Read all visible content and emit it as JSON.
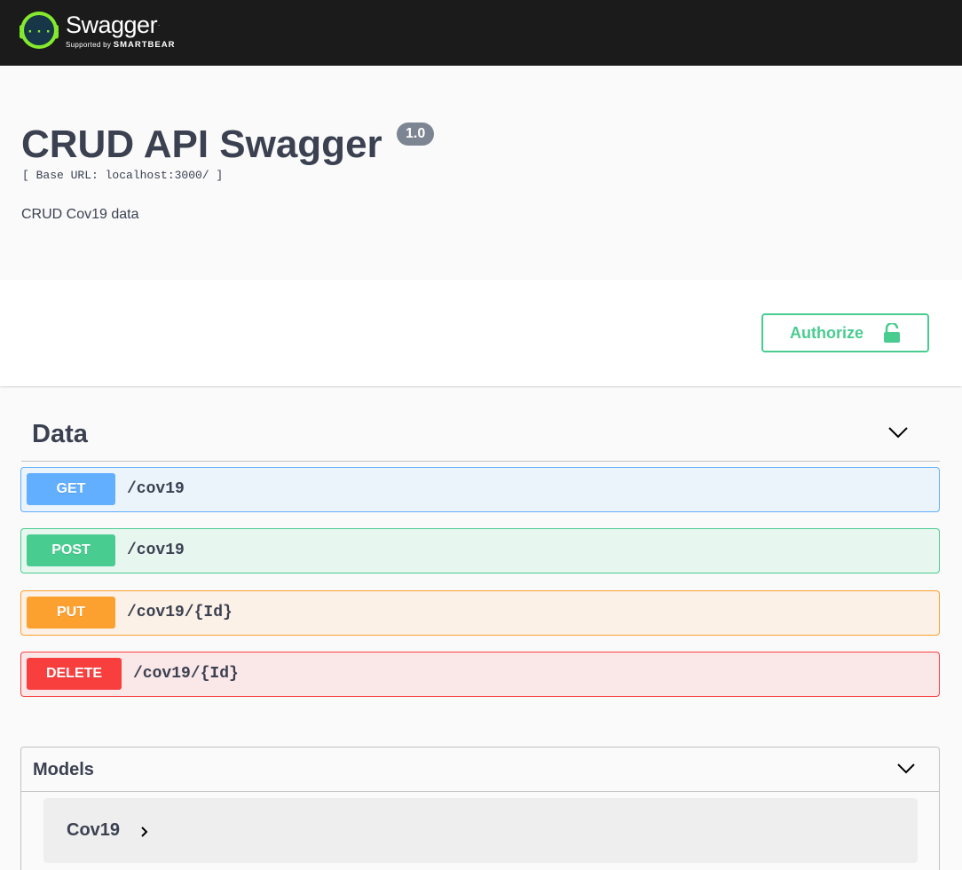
{
  "topbar": {
    "logo_title": "Swagger",
    "logo_sub_prefix": "Supported by",
    "logo_sub_brand": "SMARTBEAR"
  },
  "info": {
    "title": "CRUD API Swagger",
    "version": "1.0",
    "base_url": "[ Base URL: localhost:3000/ ]",
    "description": "CRUD Cov19 data"
  },
  "auth": {
    "button_label": "Authorize"
  },
  "tag": {
    "name": "Data",
    "operations": [
      {
        "method": "GET",
        "path": "/cov19"
      },
      {
        "method": "POST",
        "path": "/cov19"
      },
      {
        "method": "PUT",
        "path": "/cov19/{Id}"
      },
      {
        "method": "DELETE",
        "path": "/cov19/{Id}"
      }
    ]
  },
  "models": {
    "title": "Models",
    "items": [
      {
        "name": "Cov19"
      }
    ]
  },
  "colors": {
    "topbar_bg": "#1b1b1b",
    "logo_green": "#85ea2d",
    "get": "#61affe",
    "post": "#49cc90",
    "put": "#fca130",
    "delete": "#f93e3e",
    "text": "#3b4151"
  },
  "icons": {
    "logo": "swagger-logo-icon",
    "authorize": "unlocked-icon",
    "tag_toggle": "chevron-down-icon",
    "models_toggle": "chevron-down-icon",
    "model_expand": "chevron-right-icon"
  }
}
